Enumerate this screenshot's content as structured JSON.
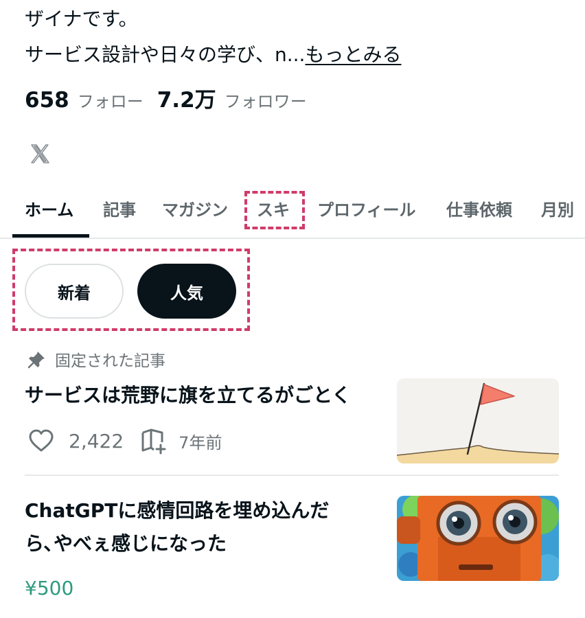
{
  "profile": {
    "bio_line1": "ザイナです。",
    "bio_line2": "サービス設計や日々の学び、n...",
    "more_label": "もっとみる",
    "following_count": "658",
    "following_label": "フォロー",
    "followers_count": "7.2万",
    "followers_label": "フォロワー",
    "social_icon": "x-icon"
  },
  "tabs": [
    {
      "label": "ホーム",
      "active": true
    },
    {
      "label": "記事"
    },
    {
      "label": "マガジン"
    },
    {
      "label": "スキ"
    },
    {
      "label": "プロフィール"
    },
    {
      "label": "仕事依頼"
    },
    {
      "label": "月別"
    }
  ],
  "filters": {
    "new_label": "新着",
    "popular_label": "人気",
    "selected": "人気"
  },
  "pinned_label": "固定された記事",
  "articles": [
    {
      "title": "サービスは荒野に旗を立てるがごとく",
      "likes": "2,422",
      "time": "7年前",
      "thumbnail": "flag-in-desert"
    },
    {
      "title_line1": "ChatGPTに感情回路を埋め込んだ",
      "title_line2": "ら､やべぇ感じになった",
      "price": "¥500",
      "thumbnail": "orange-robot"
    }
  ],
  "colors": {
    "text": "#08131a",
    "muted": "#6b7377",
    "highlight_dash": "#cf3c6a",
    "price": "#2e9a7d"
  }
}
